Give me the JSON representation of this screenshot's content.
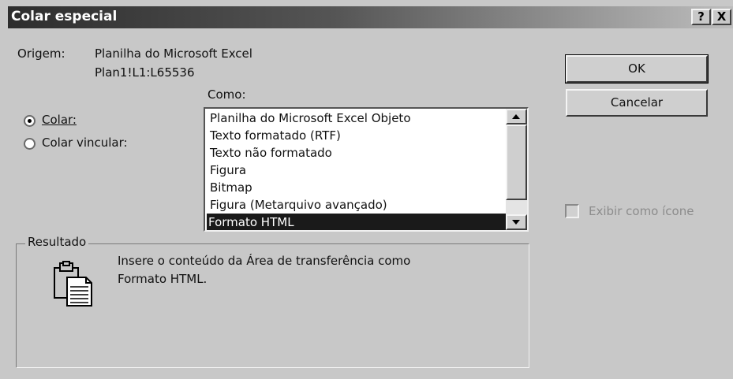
{
  "dialog": {
    "title": "Colar especial",
    "help_button": "?",
    "close_button": "X"
  },
  "source": {
    "label": "Origem:",
    "line1": "Planilha do Microsoft Excel",
    "line2": "Plan1!L1:L65536"
  },
  "paste_options": {
    "paste_label": "Colar:",
    "paste_link_label": "Colar vincular:",
    "selected": "paste"
  },
  "format_list": {
    "label": "Como:",
    "items": [
      "Planilha do Microsoft Excel Objeto",
      "Texto formatado (RTF)",
      "Texto não formatado",
      "Figura",
      "Bitmap",
      "Figura (Metarquivo avançado)",
      "Formato HTML"
    ],
    "selected_index": 6
  },
  "buttons": {
    "ok": "OK",
    "cancel": "Cancelar"
  },
  "display_as_icon": {
    "label": "Exibir como ícone",
    "checked": false,
    "enabled": false
  },
  "result": {
    "legend": "Resultado",
    "line1": "Insere o conteúdo da Área de transferência como",
    "line2": "Formato HTML."
  },
  "icons": {
    "clipboard": "clipboard-icon",
    "up_arrow": "scroll-up-arrow-icon",
    "down_arrow": "scroll-down-arrow-icon"
  },
  "colors": {
    "dialog_face": "#c8c8c8",
    "selection": "#1a1a1a",
    "title_dark": "#2d2d2d"
  }
}
